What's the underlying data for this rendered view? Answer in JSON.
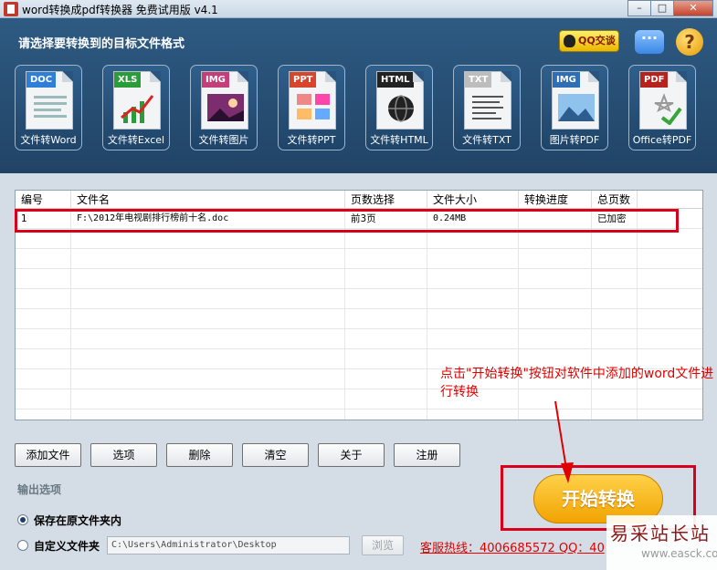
{
  "window": {
    "title": "word转换成pdf转换器 免费试用版 v4.1"
  },
  "header": {
    "title": "请选择要转换到的目标文件格式",
    "qq_chat": "QQ交谈",
    "chat_glyph": "···",
    "help_glyph": "?"
  },
  "tools": [
    {
      "tag": "DOC",
      "label": "文件转Word",
      "color": "#2f7ed8"
    },
    {
      "tag": "XLS",
      "label": "文件转Excel",
      "color": "#2a9d3a"
    },
    {
      "tag": "IMG",
      "label": "文件转图片",
      "color": "#c23f7a"
    },
    {
      "tag": "PPT",
      "label": "文件转PPT",
      "color": "#d6452c"
    },
    {
      "tag": "HTML",
      "label": "文件转HTML",
      "color": "#222222"
    },
    {
      "tag": "TXT",
      "label": "文件转TXT",
      "color": "#bdbdbd"
    },
    {
      "tag": "IMG",
      "label": "图片转PDF",
      "color": "#2f6db5"
    },
    {
      "tag": "PDF",
      "label": "Office转PDF",
      "color": "#b6231d"
    }
  ],
  "table": {
    "headers": [
      "编号",
      "文件名",
      "页数选择",
      "文件大小",
      "转换进度",
      "总页数"
    ],
    "rows": [
      [
        "1",
        "F:\\2012年电视剧排行榜前十名.doc",
        "前3页",
        "0.24MB",
        "",
        "已加密"
      ]
    ]
  },
  "annotation": "点击\"开始转换\"按钮对软件中添加的word文件进行转换",
  "buttons": {
    "add": "添加文件",
    "options": "选项",
    "delete": "删除",
    "clear": "清空",
    "about": "关于",
    "register": "注册",
    "start": "开始转换",
    "browse": "浏览"
  },
  "output": {
    "title": "输出选项",
    "option_original": "保存在原文件夹内",
    "option_custom": "自定义文件夹",
    "selected": "original",
    "path": "C:\\Users\\Administrator\\Desktop"
  },
  "hotline": "客服热线：4006685572 QQ：40",
  "watermark": {
    "title": "易采站长站",
    "url": "www.easck.com"
  }
}
